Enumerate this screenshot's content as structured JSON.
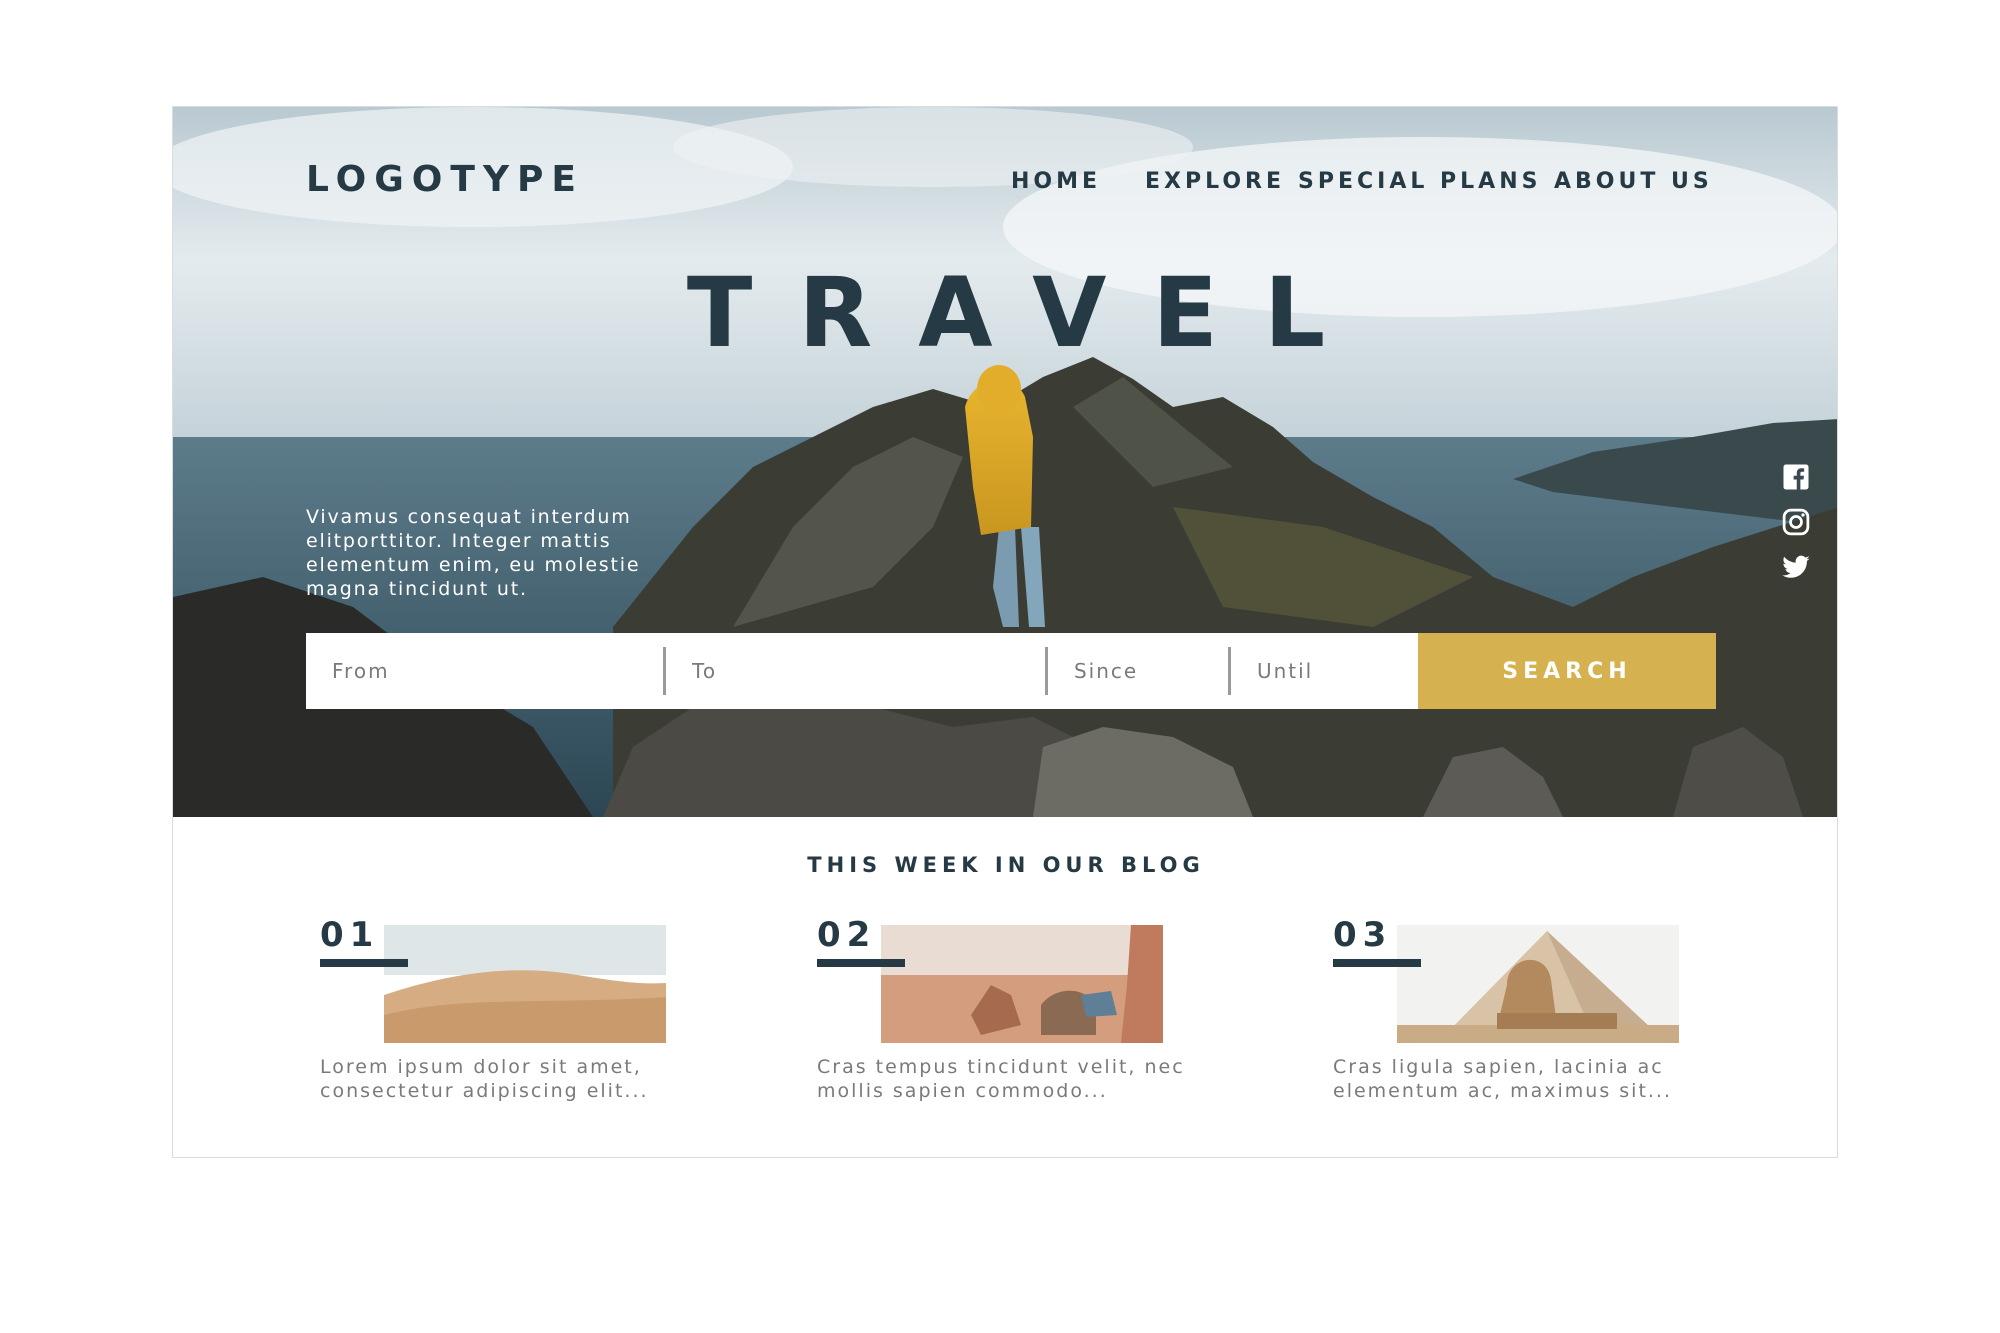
{
  "header": {
    "logo": "LOGOTYPE",
    "nav": [
      {
        "label": "HOME"
      },
      {
        "label": "EXPLORE"
      },
      {
        "label": "SPECIAL PLANS"
      },
      {
        "label": "ABOUT US"
      }
    ]
  },
  "hero": {
    "title": "TRAVEL",
    "text": "Vivamus consequat interdum elitporttitor. Integer mattis elementum enim, eu molestie magna tincidunt ut."
  },
  "social": {
    "icons": [
      "facebook-icon",
      "instagram-icon",
      "twitter-icon"
    ]
  },
  "search": {
    "from_placeholder": "From",
    "to_placeholder": "To",
    "since_placeholder": "Since",
    "until_placeholder": "Until",
    "button_label": "SEARCH"
  },
  "blog": {
    "title": "THIS WEEK IN OUR BLOG",
    "posts": [
      {
        "number": "01",
        "excerpt": "Lorem ipsum dolor sit amet, consectetur adipiscing elit..."
      },
      {
        "number": "02",
        "excerpt": "Cras tempus tincidunt velit, nec mollis sapien commodo..."
      },
      {
        "number": "03",
        "excerpt": "Cras ligula sapien, lacinia ac elementum ac, maximus sit..."
      }
    ]
  },
  "colors": {
    "text_dark": "#253a45",
    "accent": "#d6b14f",
    "muted_text": "#7a7a7a",
    "background": "#ffffff"
  }
}
